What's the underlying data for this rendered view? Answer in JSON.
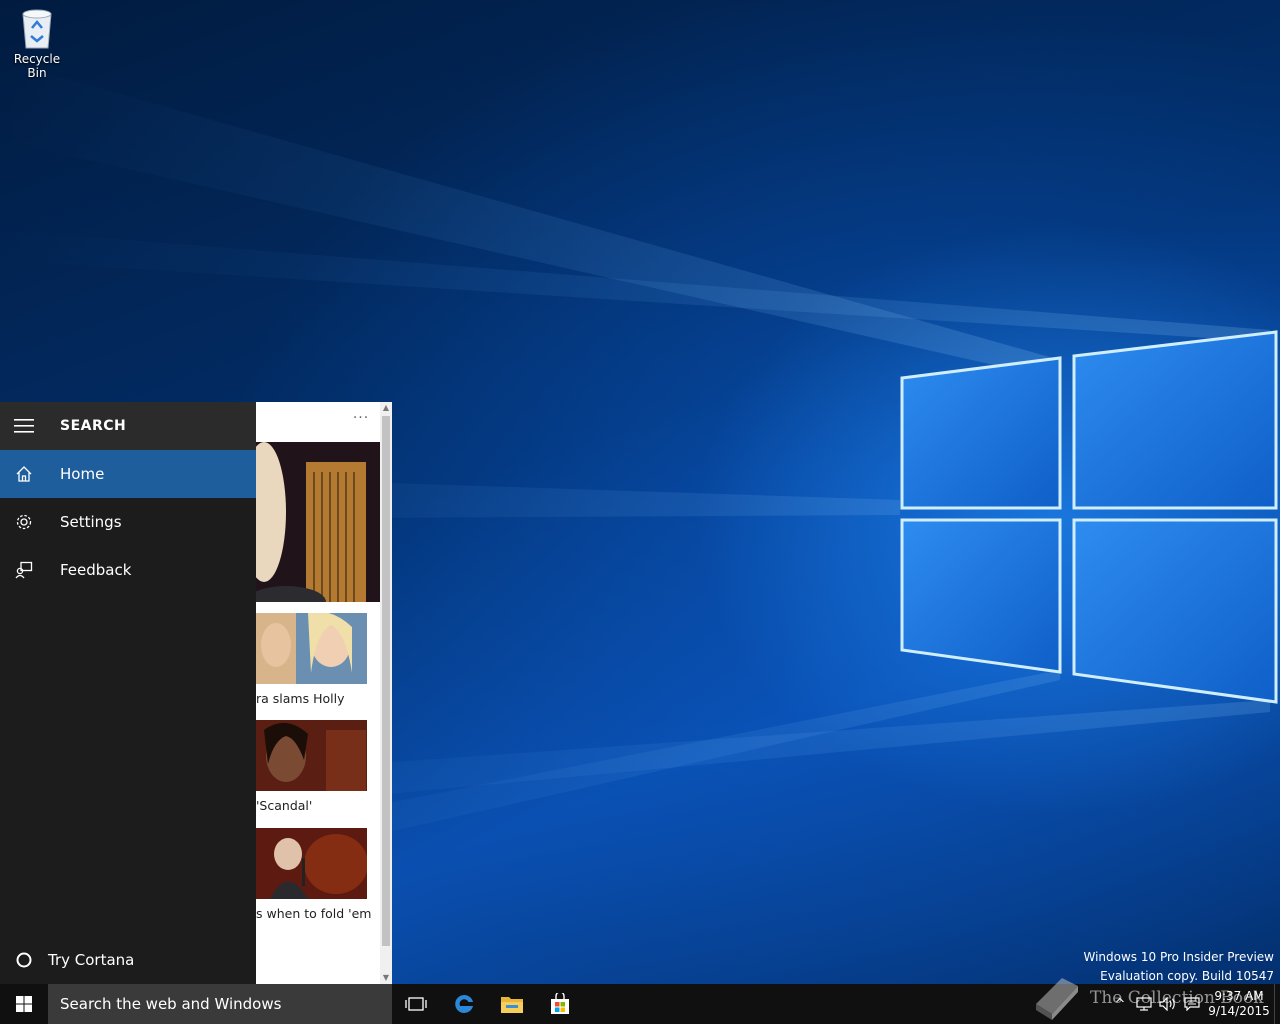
{
  "desktop": {
    "recycle_bin_label": "Recycle Bin"
  },
  "search_panel": {
    "title": "SEARCH",
    "nav_items": [
      {
        "label": "Home",
        "icon": "home-icon",
        "active": true
      },
      {
        "label": "Settings",
        "icon": "gear-icon",
        "active": false
      },
      {
        "label": "Feedback",
        "icon": "feedback-icon",
        "active": false
      }
    ],
    "try_cortana_label": "Try Cortana",
    "accent_color": "#1e5e9c"
  },
  "news_feed": {
    "more_label": "···",
    "captions": [
      "ra slams Holly",
      "'Scandal'",
      "s when to fold 'em"
    ]
  },
  "taskbar": {
    "search_placeholder": "Search the web and Windows",
    "pinned": [
      "task-view-icon",
      "edge-icon",
      "file-explorer-icon",
      "store-icon"
    ],
    "clock_time": "9:37 AM",
    "clock_date": "9/14/2015"
  },
  "watermark": {
    "line1": "Windows 10 Pro Insider Preview",
    "line2": "Evaluation copy. Build 10547"
  },
  "overlay_watermark": {
    "text": "The Collection Book"
  }
}
